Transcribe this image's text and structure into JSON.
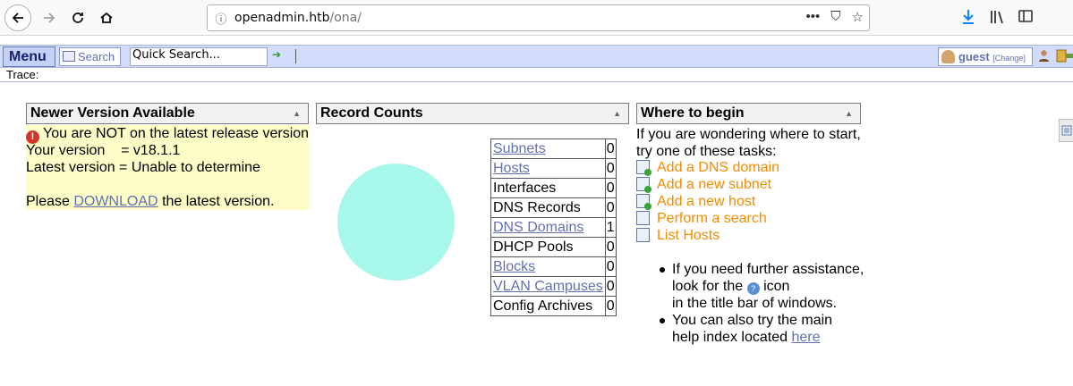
{
  "browser": {
    "url_host": "openadmin.htb",
    "url_path": "/ona/",
    "url_info_icon": "info-icon",
    "url_actions": [
      "•••",
      "⛉",
      "☆"
    ],
    "toolbar_icons": [
      "download-icon",
      "library-icon",
      "sidebar-icon"
    ]
  },
  "toolbar": {
    "menu_label": "Menu",
    "search_label": "Search",
    "quick_search_value": "Quick Search...",
    "user_name": "guest",
    "user_change": "[Change]",
    "trace_label": "Trace:"
  },
  "newer_version": {
    "title": "Newer Version Available",
    "warning": "You are NOT on the latest release version",
    "your_version": "Your version    = v18.1.1",
    "latest_version": "Latest version = Unable to determine",
    "please": "Please",
    "download_link": "DOWNLOAD",
    "download_suffix": "the latest version."
  },
  "record_counts": {
    "title": "Record Counts",
    "rows": [
      {
        "name": "Subnets",
        "count": "0",
        "link": true
      },
      {
        "name": "Hosts",
        "count": "0",
        "link": true
      },
      {
        "name": "Interfaces",
        "count": "0",
        "link": false
      },
      {
        "name": "DNS Records",
        "count": "0",
        "link": false
      },
      {
        "name": "DNS Domains",
        "count": "1",
        "link": true
      },
      {
        "name": "DHCP Pools",
        "count": "0",
        "link": false
      },
      {
        "name": "Blocks",
        "count": "0",
        "link": true
      },
      {
        "name": "VLAN Campuses",
        "count": "0",
        "link": true
      },
      {
        "name": "Config Archives",
        "count": "0",
        "link": false
      }
    ],
    "pie_color": "#a7f7ea"
  },
  "where_to_begin": {
    "title": "Where to begin",
    "intro_1": "If you are wondering where to start,",
    "intro_2": "try one of these tasks:",
    "tasks": [
      {
        "label": "Add a DNS domain",
        "icon": "add-doc-icon"
      },
      {
        "label": "Add a new subnet",
        "icon": "add-doc-icon"
      },
      {
        "label": "Add a new host",
        "icon": "add-doc-icon"
      },
      {
        "label": "Perform a search",
        "icon": "search-form-icon"
      },
      {
        "label": "List Hosts",
        "icon": "list-icon"
      }
    ],
    "help_1a": "If you need further assistance,",
    "help_1b": "look for the",
    "help_1c": "icon",
    "help_1d": "in the title bar of windows.",
    "help_2a": "You can also try the main",
    "help_2b": "help index located",
    "help_link": "here"
  },
  "colors": {
    "toolbar_bg": "#d2dcfd",
    "link": "#6170b0",
    "task": "#f28c00",
    "notice_bg": "#fdfdc8"
  }
}
